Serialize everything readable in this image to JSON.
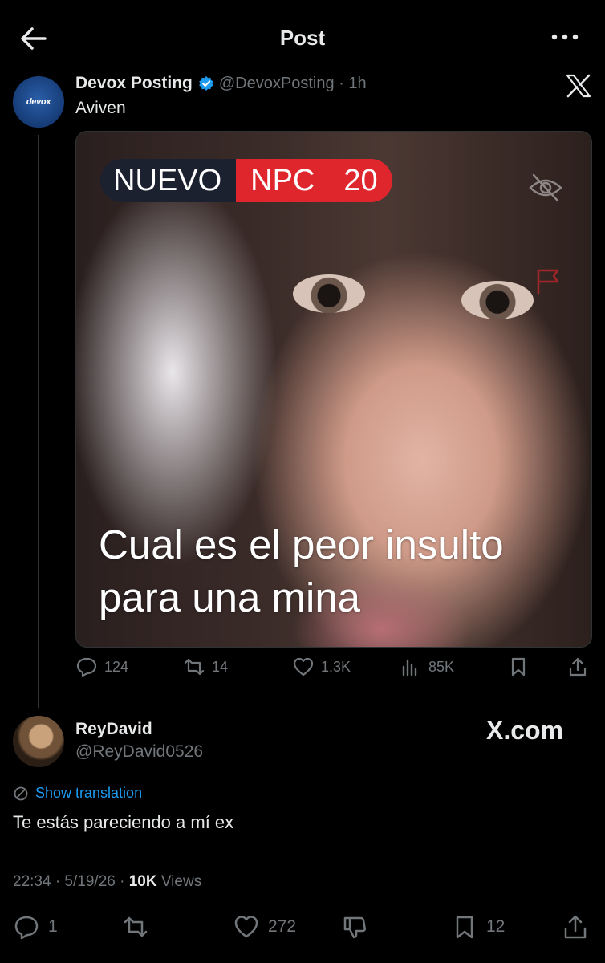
{
  "header": {
    "title": "Post"
  },
  "post": {
    "author_name": "Devox Posting",
    "author_handle": "@DevoxPosting · 1h",
    "avatar_text": "devox",
    "text": "Aviven",
    "media": {
      "badge_left": "NUEVO",
      "badge_mid": "NPC",
      "badge_num": "20",
      "caption_line1": "Cual es el peor insulto",
      "caption_line2": "para una mina"
    },
    "stats": {
      "replies": "124",
      "reposts": "14",
      "likes": "1.3K",
      "views": "85K"
    }
  },
  "reply": {
    "author_name": "ReyDavid",
    "author_handle": "@ReyDavid0526",
    "watermark": "X.com",
    "translate_label": "Show translation",
    "text": "Te estás pareciendo a mí ex",
    "timestamp": "22:34 · 5/19/26 · ",
    "views_count": "10K",
    "views_label": " Views",
    "stats": {
      "replies": "1",
      "likes": "272",
      "bookmarks": "12"
    }
  },
  "colors": {
    "background": "#000000",
    "text": "#e7e9ea",
    "muted": "#71767b",
    "link": "#1d9bf0",
    "verified": "#1d9bf0",
    "badge_red": "#e0262d"
  }
}
